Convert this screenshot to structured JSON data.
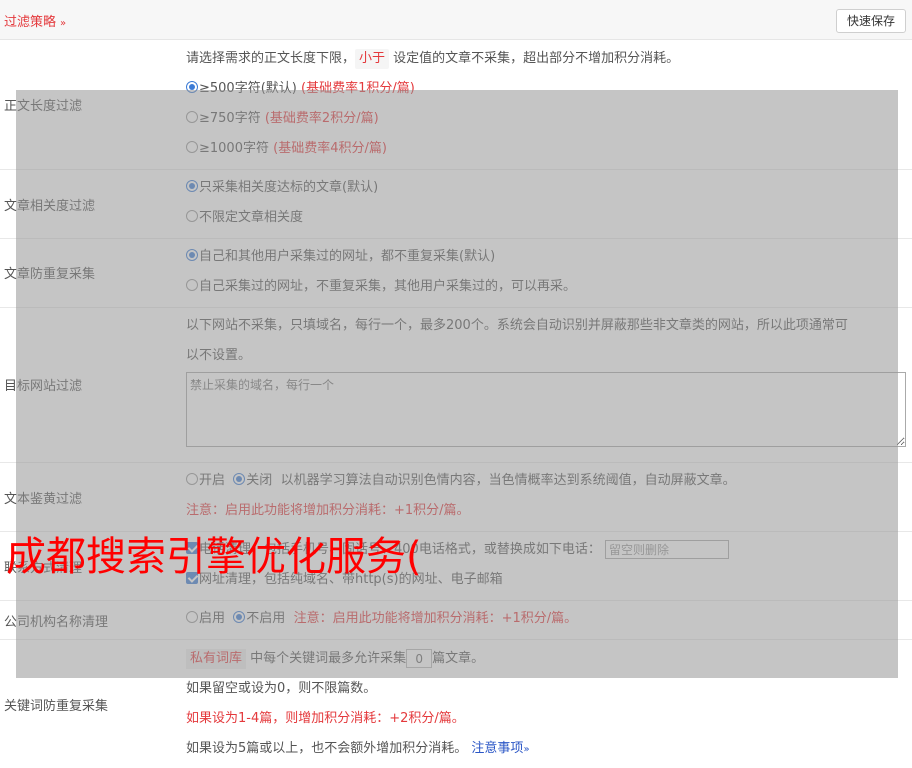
{
  "header": {
    "title": "过滤策略",
    "save_label": "快速保存"
  },
  "content_length": {
    "label": "正文长度过滤",
    "desc_before": "请选择需求的正文长度下限，",
    "desc_pill": "小于",
    "desc_after": "设定值的文章不采集，超出部分不增加积分消耗。",
    "options": [
      {
        "text": "≥500字符(默认)",
        "note": "(基础费率1积分/篇)",
        "checked": true
      },
      {
        "text": "≥750字符",
        "note": "(基础费率2积分/篇)",
        "checked": false
      },
      {
        "text": "≥1000字符",
        "note": "(基础费率4积分/篇)",
        "checked": false
      }
    ]
  },
  "relevance": {
    "label": "文章相关度过滤",
    "options": [
      {
        "text": "只采集相关度达标的文章(默认)",
        "checked": true
      },
      {
        "text": "不限定文章相关度",
        "checked": false
      }
    ]
  },
  "dedupe": {
    "label": "文章防重复采集",
    "options": [
      {
        "text": "自己和其他用户采集过的网址，都不重复采集(默认)",
        "checked": true
      },
      {
        "text": "自己采集过的网址，不重复采集，其他用户采集过的，可以再采。",
        "checked": false
      }
    ]
  },
  "site_filter": {
    "label": "目标网站过滤",
    "desc_line1": "以下网站不采集，只填域名，每行一个，最多200个。系统会自动识别并屏蔽那些非文章类的网站，所以此项通常可",
    "desc_line2": "以不设置。",
    "placeholder": "禁止采集的域名，每行一个"
  },
  "porn_filter": {
    "label": "文本鉴黄过滤",
    "on_label": "开启",
    "off_label": "关闭",
    "selected": "off",
    "desc": "以机器学习算法自动识别色情内容，当色情概率达到系统阈值，自动屏蔽文章。",
    "notice": "注意：启用此功能将增加积分消耗：+1积分/篇。"
  },
  "contact_cleanup": {
    "label": "联系方式清理",
    "phone_text": "电话清理，包括手机号、固话号、400电话格式，或替换成如下电话：",
    "phone_placeholder": "留空则删除",
    "url_text": "网址清理，包括纯域名、带http(s)的网址、电子邮箱"
  },
  "org_cleanup": {
    "label": "公司机构名称清理",
    "on_label": "启用",
    "off_label": "不启用",
    "selected": "off",
    "notice": "注意：启用此功能将增加积分消耗：+1积分/篇。"
  },
  "keyword_dedupe": {
    "label": "关键词防重复采集",
    "pill": "私有词库",
    "text_before": "中每个关键词最多允许采集",
    "value": "0",
    "text_after": "篇文章。",
    "line2": "如果留空或设为0，则不限篇数。",
    "line3": "如果设为1-4篇，则增加积分消耗：+2积分/篇。",
    "line4": "如果设为5篇或以上，也不会额外增加积分消耗。",
    "link": "注意事项"
  },
  "watermark": "成都搜索引擎优化服务(",
  "colors": {
    "accent_red": "#e4393c",
    "radio_blue": "#3d7cd6",
    "overlay_gray": "rgba(150,150,150,0.55)",
    "watermark_red": "#ff0000"
  }
}
